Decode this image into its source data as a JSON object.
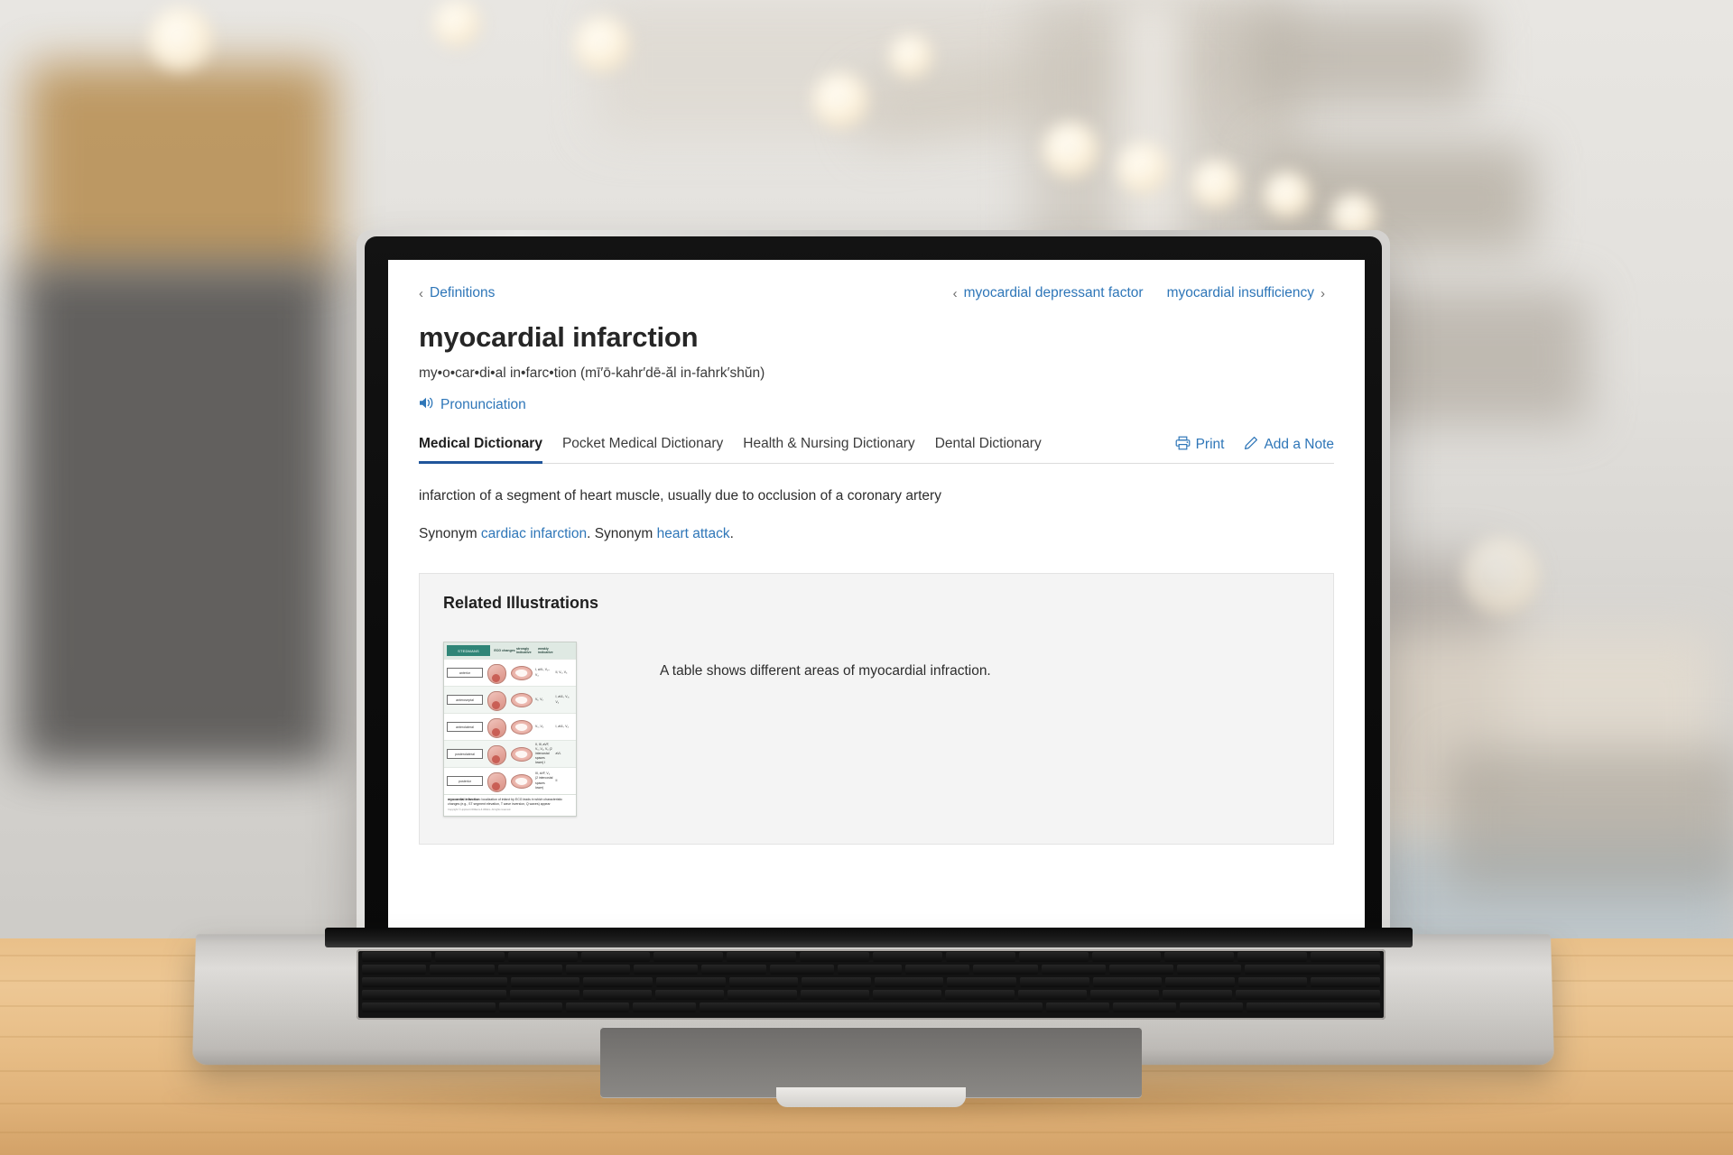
{
  "device": {
    "type": "laptop",
    "surface": "wooden-desk"
  },
  "page": {
    "breadcrumb": {
      "label": "Definitions",
      "icon": "chevron-left-icon"
    },
    "prev_entry": {
      "label": "myocardial depressant factor",
      "icon": "chevron-left-icon"
    },
    "next_entry": {
      "label": "myocardial insufficiency",
      "icon": "chevron-right-icon"
    },
    "entry_title": "myocardial infarction",
    "phonetic": "my•o•car•di•al in•farc•tion (mī′ō-kahr′dē-ăl in-fahrk′shŭn)",
    "pronunciation": {
      "label": "Pronunciation",
      "icon": "speaker-icon"
    },
    "tabs": [
      {
        "label": "Medical Dictionary",
        "active": true
      },
      {
        "label": "Pocket Medical Dictionary",
        "active": false
      },
      {
        "label": "Health & Nursing Dictionary",
        "active": false
      },
      {
        "label": "Dental Dictionary",
        "active": false
      }
    ],
    "actions": [
      {
        "label": "Print",
        "icon": "printer-icon"
      },
      {
        "label": "Add a Note",
        "icon": "pencil-icon"
      }
    ],
    "definition": "infarction of a segment of heart muscle, usually due to occlusion of a coronary artery",
    "synonyms": {
      "prefix_1": "Synonym ",
      "term_1": "cardiac infarction",
      "middle": ". Synonym ",
      "term_2": "heart attack",
      "suffix": "."
    },
    "illustrations": {
      "title": "Related Illustrations",
      "caption": "A table shows different areas of myocardial infraction.",
      "thumbnail": {
        "brand": "STEDMANS",
        "columns": [
          "ECG changes",
          "strongly indicative",
          "weakly indicative"
        ],
        "rows": [
          {
            "region": "anterior",
            "strong": "I, aVL,\nV₁–V₄",
            "weak": "II,\nV₅, V₆"
          },
          {
            "region": "anteroseptal",
            "strong": "V₁, V₂",
            "weak": "I, aVL,\nV₃, V₄"
          },
          {
            "region": "anterolateral",
            "strong": "V₅, V₆",
            "weak": "I, aVL,\nV₄"
          },
          {
            "region": "posterolateral",
            "strong": "II, III, aVF,\nV₅, V₆,\nV₆ (2 intercostal spaces lower)\nI",
            "weak": "aVL"
          },
          {
            "region": "posterior",
            "strong": "III, aVF,\nV₆ (2 intercostal spaces lower)",
            "weak": "II"
          }
        ],
        "footnote_term": "myocardial infarction:",
        "footnote_text": " localization of infarct by ECG leads in which characteristic changes (e.g., ST segment elevation, T wave inversion, Q waves) appear",
        "copyright": "Copyright © Lippincott Williams & Wilkins. All rights reserved."
      }
    }
  },
  "colors": {
    "link": "#2e76b8",
    "active_tab_underline": "#20559b",
    "panel_bg": "#f4f4f4",
    "text": "#2d2d2d",
    "brand_teal": "#2f8577"
  }
}
